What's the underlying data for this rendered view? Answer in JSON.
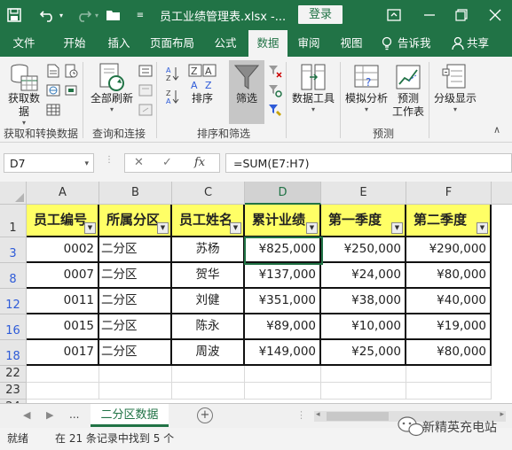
{
  "titlebar": {
    "title": "员工业绩管理表.xlsx  -...",
    "login": "登录",
    "icons": [
      "save-icon",
      "undo-icon",
      "redo-icon",
      "open-folder-icon",
      "customize-icon"
    ]
  },
  "tabs": [
    "文件",
    "开始",
    "插入",
    "页面布局",
    "公式",
    "数据",
    "审阅",
    "视图",
    "告诉我",
    "共享"
  ],
  "active_tab": "数据",
  "ribbon": {
    "get_data_line1": "获取数",
    "get_data_line2": "据",
    "refresh_all": "全部刷新",
    "sort": "排序",
    "filter": "筛选",
    "data_tools": "数据工具",
    "what_if": "模拟分析",
    "forecast_line1": "预测",
    "forecast_line2": "工作表",
    "outline": "分级显示",
    "group_get": "获取和转换数据",
    "group_query": "查询和连接",
    "group_sort": "排序和筛选",
    "group_forecast": "预测"
  },
  "formula_bar": {
    "name_box": "D7",
    "formula": "=SUM(E7:H7)",
    "fx": "fx"
  },
  "columns": [
    "A",
    "B",
    "C",
    "D",
    "E",
    "F"
  ],
  "selected_column": "D",
  "rows": [
    "1",
    "3",
    "8",
    "12",
    "16",
    "18",
    "22",
    "23",
    "24"
  ],
  "filtered_rows": [
    "3",
    "8",
    "12",
    "16",
    "18"
  ],
  "table": {
    "headers": [
      "员工编号",
      "所属分区",
      "员工姓名",
      "累计业绩",
      "第一季度",
      "第二季度"
    ],
    "rows": [
      [
        "0002",
        "二分区",
        "苏杨",
        "¥825,000",
        "¥250,000",
        "¥290,000"
      ],
      [
        "0007",
        "二分区",
        "贺华",
        "¥137,000",
        "¥24,000",
        "¥80,000"
      ],
      [
        "0011",
        "二分区",
        "刘健",
        "¥351,000",
        "¥38,000",
        "¥40,000"
      ],
      [
        "0015",
        "二分区",
        "陈永",
        "¥89,000",
        "¥10,000",
        "¥19,000"
      ],
      [
        "0017",
        "二分区",
        "周波",
        "¥149,000",
        "¥25,000",
        "¥80,000"
      ]
    ]
  },
  "sheet": {
    "ellipsis": "...",
    "active_sheet": "二分区数据"
  },
  "status": {
    "ready": "就绪",
    "message": "在 21 条记录中找到 5 个"
  },
  "watermark": "新精英充电站",
  "colors": {
    "accent": "#217346",
    "header_fill": "#ffff66",
    "row_number_blue": "#2e5bd8"
  }
}
